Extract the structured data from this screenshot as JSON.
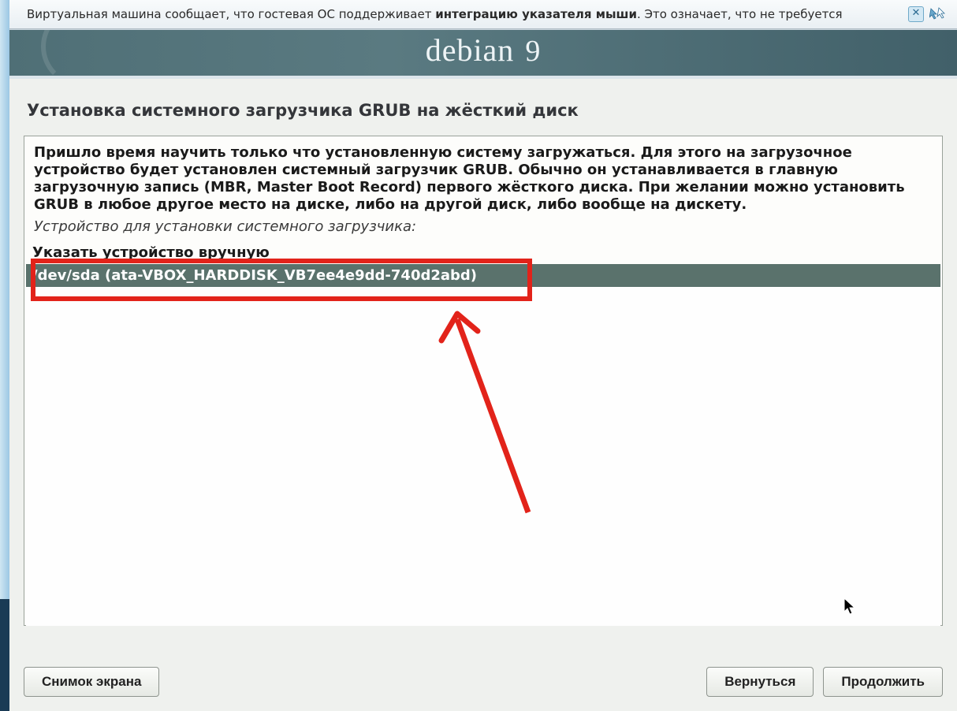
{
  "notice": {
    "text_prefix": "Виртуальная машина сообщает, что гостевая ОС поддерживает ",
    "text_bold": "интеграцию указателя мыши",
    "text_suffix": ". Это означает, что не требуется"
  },
  "banner": {
    "brand": "debian",
    "version": "9"
  },
  "page": {
    "title": "Установка системного загрузчика GRUB на жёсткий диск",
    "description": "Пришло время научить только что установленную систему загружаться. Для этого на загрузочное устройство будет установлен системный загрузчик GRUB. Обычно он устанавливается в главную загрузочную запись (MBR, Master Boot Record) первого жёсткого диска. При желании можно установить GRUB в любое другое место на диске, либо на другой диск, либо вообще на дискету.",
    "prompt": "Устройство для установки системного загрузчика:"
  },
  "options": [
    {
      "label": "Указать устройство вручную",
      "selected": false
    },
    {
      "label": "/dev/sda  (ata-VBOX_HARDDISK_VB7ee4e9dd-740d2abd)",
      "selected": true
    }
  ],
  "buttons": {
    "screenshot": "Снимок экрана",
    "back": "Вернуться",
    "continue": "Продолжить"
  }
}
